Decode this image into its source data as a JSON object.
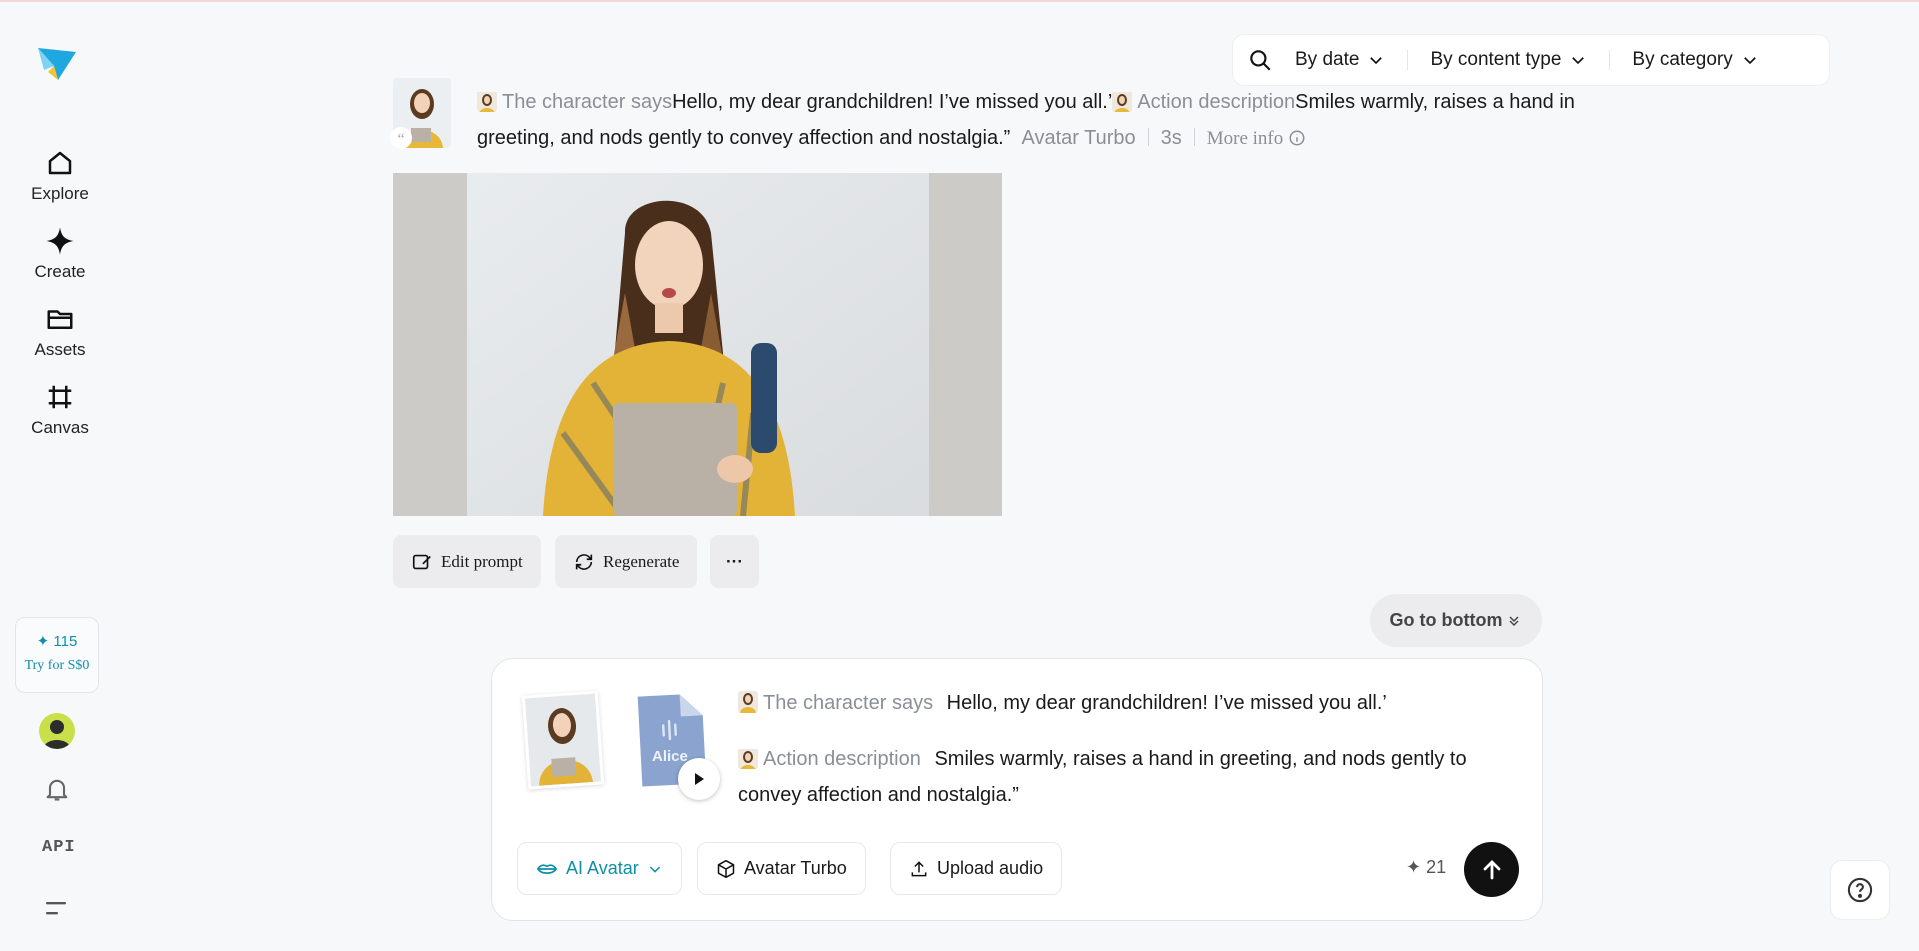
{
  "sidebar": {
    "logo_icon": "paper-plane-logo",
    "items": [
      {
        "label": "Explore",
        "icon": "home-icon"
      },
      {
        "label": "Create",
        "icon": "sparkle-icon"
      },
      {
        "label": "Assets",
        "icon": "folder-icon"
      },
      {
        "label": "Canvas",
        "icon": "crop-icon"
      }
    ],
    "credits": {
      "count": "115",
      "cta": "Try for S$0"
    },
    "api_label": "API"
  },
  "filters": {
    "by_date": "By date",
    "by_content_type": "By content type",
    "by_category": "By category"
  },
  "message": {
    "character_says_label": "The character says",
    "character_says_text": "Hello, my dear grandchildren! I’ve missed you all.’",
    "action_label": "Action description",
    "action_text": "Smiles warmly, raises a hand in greeting, and nods gently to convey affection and nostalgia.”",
    "model": "Avatar Turbo",
    "duration": "3s",
    "more_info": "More info"
  },
  "actions": {
    "edit_prompt": "Edit prompt",
    "regenerate": "Regenerate",
    "more": "···"
  },
  "go_to_bottom": "Go to bottom",
  "composer": {
    "audio_name": "Alice",
    "character_says_label": "The character says",
    "character_says_text": "Hello, my dear grandchildren! I’ve missed you all.’",
    "action_label": "Action description",
    "action_text": "Smiles warmly, raises a hand in greeting, and nods gently to convey affection and nostalgia.”",
    "mode": "AI Avatar",
    "model": "Avatar Turbo",
    "upload_audio": "Upload audio",
    "cost": "21"
  },
  "colors": {
    "accent": "#0e8fa7",
    "send": "#111111",
    "background": "#f7f8fa"
  }
}
